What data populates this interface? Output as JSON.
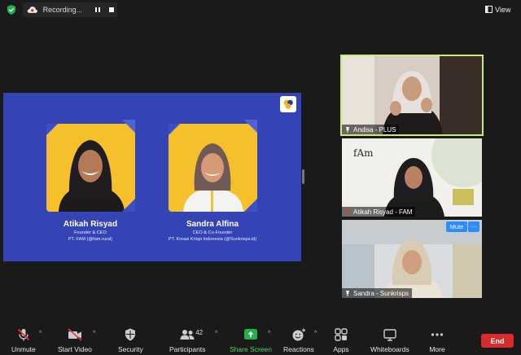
{
  "topbar": {
    "recording_label": "Recording...",
    "view_label": "View"
  },
  "slide": {
    "speakers": [
      {
        "name": "Atikah Risyad",
        "role": "Founder & CEO",
        "org": "PT. FAM (@fam.rural)"
      },
      {
        "name": "Sandra Alfina",
        "role": "CEO & Co-Founder",
        "org": "PT. Kreasi Krispi Indonesia (@Sunkrisps.id)"
      }
    ]
  },
  "participants": [
    {
      "name": "Andisa - PLUS",
      "active": true
    },
    {
      "name": "Atikah Risyad - FAM",
      "active": false
    },
    {
      "name": "Sandra - Sunkrisps",
      "active": false
    }
  ],
  "tile_controls": {
    "mute_label": "Mute",
    "more_label": "···"
  },
  "toolbar": {
    "unmute": "Unmute",
    "start_video": "Start Video",
    "security": "Security",
    "participants": "Participants",
    "participant_count": "42",
    "share_screen": "Share Screen",
    "reactions": "Reactions",
    "apps": "Apps",
    "whiteboards": "Whiteboards",
    "more": "More",
    "end": "End"
  },
  "colors": {
    "slide_bg": "#3544b4",
    "photo_bg": "#f5c02c",
    "active_border": "#c9ec6f",
    "end_red": "#d92b2b",
    "share_green": "#4ad66d",
    "accent_blue": "#2d8cff"
  }
}
